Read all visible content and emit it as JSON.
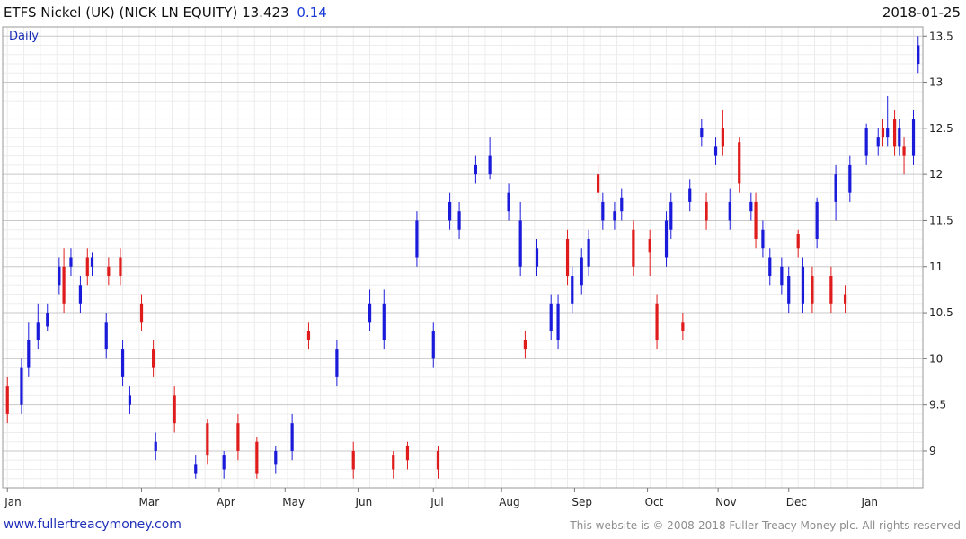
{
  "header": {
    "title": "ETFS Nickel (UK) (NICK LN EQUITY) 13.423",
    "change": "0.14",
    "date": "2018-01-25"
  },
  "footer": {
    "site": "www.fullertreacymoney.com",
    "copyright": "This website is © 2008-2018 Fuller Treacy Money plc. All rights reserved"
  },
  "colors": {
    "up": "#1a1adb",
    "down": "#e01b1b",
    "grid": "#d9d9d9",
    "text_accent": "#1a3ad8"
  },
  "chart_data": {
    "type": "candlestick",
    "title": "ETFS Nickel (UK) (NICK LN EQUITY)",
    "period_label": "Daily",
    "x_ticks": [
      "Jan",
      "Mar",
      "Apr",
      "May",
      "Jun",
      "Jul",
      "Aug",
      "Sep",
      "Oct",
      "Nov",
      "Dec",
      "Jan"
    ],
    "y_ticks": [
      "9",
      "9.5",
      "10",
      "10.5",
      "11",
      "11.5",
      "12",
      "12.5",
      "13",
      "13.5"
    ],
    "ylim": [
      8.6,
      13.6
    ],
    "y_axis_side": "right",
    "grid": true,
    "series": [
      {
        "name": "up",
        "color": "#1a1adb",
        "x": [
          "2017-01-09",
          "2017-01-12",
          "2017-01-16",
          "2017-01-20",
          "2017-01-25",
          "2017-01-30",
          "2017-02-03",
          "2017-02-08",
          "2017-02-14",
          "2017-02-21",
          "2017-02-24",
          "2017-03-07",
          "2017-03-24",
          "2017-04-05",
          "2017-04-27",
          "2017-05-04",
          "2017-05-23",
          "2017-06-06",
          "2017-06-12",
          "2017-06-26",
          "2017-07-03",
          "2017-07-10",
          "2017-07-14",
          "2017-07-21",
          "2017-07-27",
          "2017-08-04",
          "2017-08-09",
          "2017-08-16",
          "2017-08-22",
          "2017-08-25",
          "2017-08-31",
          "2017-09-04",
          "2017-09-07",
          "2017-09-13",
          "2017-09-18",
          "2017-09-21",
          "2017-10-10",
          "2017-10-12",
          "2017-10-20",
          "2017-10-25",
          "2017-10-31",
          "2017-11-06",
          "2017-11-15",
          "2017-11-20",
          "2017-11-23",
          "2017-11-28",
          "2017-12-01",
          "2017-12-07",
          "2017-12-13",
          "2017-12-21",
          "2017-12-27",
          "2018-01-03",
          "2018-01-08",
          "2018-01-12",
          "2018-01-17",
          "2018-01-23",
          "2018-01-25"
        ],
        "open": [
          9.5,
          9.9,
          10.2,
          10.35,
          10.8,
          11.0,
          10.6,
          11.0,
          10.1,
          9.8,
          9.5,
          9.0,
          8.75,
          8.8,
          8.85,
          9.0,
          9.8,
          10.4,
          10.2,
          11.1,
          10.0,
          11.5,
          11.4,
          12.0,
          12.0,
          11.6,
          11.0,
          11.0,
          10.3,
          10.2,
          10.6,
          10.8,
          11.0,
          11.5,
          11.5,
          11.6,
          11.1,
          11.4,
          11.7,
          12.4,
          12.2,
          11.5,
          11.6,
          11.2,
          10.9,
          10.8,
          10.6,
          10.6,
          11.3,
          11.7,
          11.8,
          12.2,
          12.3,
          12.4,
          12.3,
          12.2,
          13.2
        ],
        "close": [
          9.9,
          10.2,
          10.4,
          10.5,
          11.0,
          11.1,
          10.8,
          11.1,
          10.4,
          10.1,
          9.6,
          9.1,
          8.85,
          8.95,
          9.0,
          9.3,
          10.1,
          10.6,
          10.6,
          11.5,
          10.3,
          11.7,
          11.6,
          12.1,
          12.2,
          11.8,
          11.5,
          11.2,
          10.6,
          10.6,
          10.9,
          11.1,
          11.3,
          11.7,
          11.6,
          11.75,
          11.5,
          11.7,
          11.85,
          12.5,
          12.3,
          11.7,
          11.7,
          11.4,
          11.1,
          11.0,
          10.9,
          11.0,
          11.7,
          12.0,
          12.1,
          12.5,
          12.4,
          12.5,
          12.5,
          12.6,
          13.4
        ],
        "high": [
          10.0,
          10.4,
          10.6,
          10.6,
          11.1,
          11.2,
          10.9,
          11.15,
          10.5,
          10.2,
          9.7,
          9.2,
          8.95,
          9.0,
          9.05,
          9.4,
          10.2,
          10.75,
          10.75,
          11.6,
          10.4,
          11.8,
          11.7,
          12.2,
          12.4,
          11.9,
          11.7,
          11.3,
          10.7,
          10.7,
          11.0,
          11.2,
          11.4,
          11.8,
          11.7,
          11.85,
          11.6,
          11.8,
          11.95,
          12.6,
          12.4,
          11.85,
          11.8,
          11.5,
          11.2,
          11.1,
          11.0,
          11.1,
          11.75,
          12.1,
          12.2,
          12.55,
          12.5,
          12.85,
          12.6,
          12.7,
          13.5
        ],
        "low": [
          9.4,
          9.8,
          10.1,
          10.3,
          10.7,
          10.9,
          10.5,
          10.9,
          10.0,
          9.7,
          9.4,
          8.9,
          8.7,
          8.7,
          8.75,
          8.9,
          9.7,
          10.3,
          10.1,
          11.0,
          9.9,
          11.4,
          11.3,
          11.9,
          11.95,
          11.5,
          10.9,
          10.9,
          10.2,
          10.1,
          10.5,
          10.7,
          10.9,
          11.4,
          11.4,
          11.5,
          11.0,
          11.3,
          11.6,
          12.3,
          12.1,
          11.4,
          11.5,
          11.1,
          10.8,
          10.7,
          10.5,
          10.5,
          11.2,
          11.5,
          11.7,
          12.1,
          12.2,
          12.3,
          12.2,
          12.1,
          13.1
        ]
      },
      {
        "name": "down",
        "color": "#e01b1b",
        "x": [
          "2017-01-03",
          "2017-01-27",
          "2017-02-06",
          "2017-02-15",
          "2017-02-20",
          "2017-03-01",
          "2017-03-06",
          "2017-03-15",
          "2017-03-29",
          "2017-04-11",
          "2017-04-19",
          "2017-05-11",
          "2017-05-30",
          "2017-06-16",
          "2017-06-22",
          "2017-07-05",
          "2017-08-11",
          "2017-08-29",
          "2017-09-11",
          "2017-09-26",
          "2017-10-03",
          "2017-10-06",
          "2017-10-17",
          "2017-10-27",
          "2017-11-03",
          "2017-11-10",
          "2017-11-17",
          "2017-12-05",
          "2017-12-11",
          "2017-12-19",
          "2017-12-25",
          "2018-01-10",
          "2018-01-15",
          "2018-01-19"
        ],
        "open": [
          9.7,
          11.0,
          11.1,
          11.0,
          11.1,
          10.6,
          10.1,
          9.6,
          9.3,
          9.3,
          9.1,
          10.3,
          9.0,
          8.95,
          9.05,
          9.0,
          10.2,
          11.3,
          12.0,
          11.4,
          11.3,
          10.6,
          10.4,
          11.7,
          12.5,
          12.35,
          11.7,
          11.35,
          10.9,
          10.9,
          10.7,
          12.5,
          12.6,
          12.3
        ],
        "close": [
          9.4,
          10.6,
          10.9,
          10.9,
          10.9,
          10.4,
          9.9,
          9.3,
          8.95,
          9.0,
          8.75,
          10.2,
          8.8,
          8.8,
          8.9,
          8.8,
          10.1,
          10.9,
          11.8,
          11.0,
          11.15,
          10.2,
          10.3,
          11.5,
          12.3,
          11.9,
          11.3,
          11.2,
          10.6,
          10.6,
          10.6,
          12.4,
          12.3,
          12.2
        ],
        "high": [
          9.8,
          11.2,
          11.2,
          11.1,
          11.2,
          10.7,
          10.2,
          9.7,
          9.35,
          9.4,
          9.15,
          10.4,
          9.1,
          9.0,
          9.1,
          9.05,
          10.3,
          11.4,
          12.1,
          11.5,
          11.4,
          10.7,
          10.5,
          11.8,
          12.7,
          12.4,
          11.8,
          11.4,
          11.0,
          11.0,
          10.8,
          12.6,
          12.7,
          12.4
        ],
        "low": [
          9.3,
          10.5,
          10.8,
          10.8,
          10.8,
          10.3,
          9.8,
          9.2,
          8.85,
          8.9,
          8.7,
          10.1,
          8.7,
          8.7,
          8.8,
          8.7,
          10.0,
          10.8,
          11.7,
          10.9,
          10.9,
          10.1,
          10.2,
          11.4,
          12.2,
          11.8,
          11.2,
          11.1,
          10.5,
          10.5,
          10.5,
          12.3,
          12.2,
          12.0
        ]
      }
    ]
  }
}
